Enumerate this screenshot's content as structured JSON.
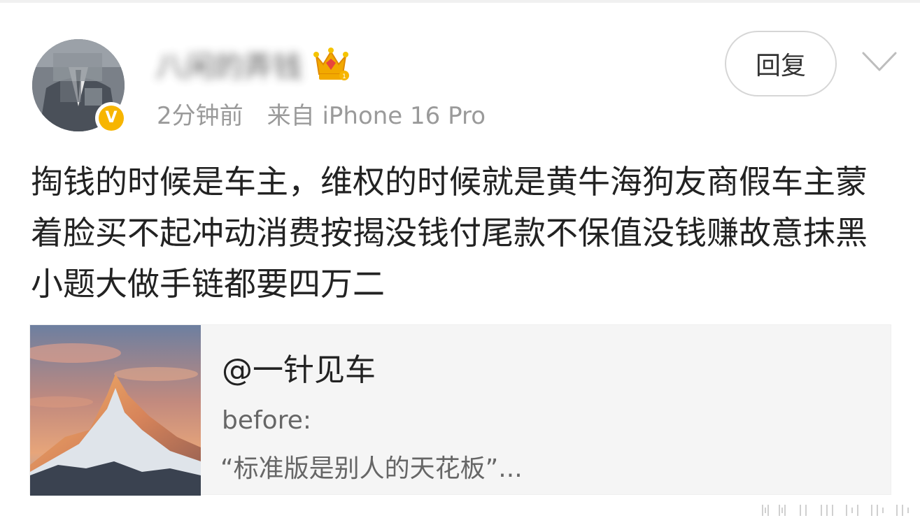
{
  "post": {
    "author": {
      "name": "八闲的弄钱",
      "verified_label": "V"
    },
    "meta": {
      "time": "2分钟前",
      "source": "来自 iPhone 16 Pro"
    },
    "reply_label": "回复",
    "text": "掏钱的时候是车主，维权的时候就是黄牛海狗友商假车主蒙着脸买不起冲动消费按揭没钱付尾款不保值没钱赚故意抹黑小题大做手链都要四万二",
    "quote_card": {
      "title": "@一针见车",
      "line1": "before:",
      "line2": "“标准版是别人的天花板”..."
    }
  },
  "icons": {
    "crown": "crown-icon",
    "verified": "verified-badge-icon",
    "more": "chevron-down-icon"
  },
  "colors": {
    "verified": "#f7b500",
    "meta_text": "#9a9a9a",
    "card_bg": "#f5f5f5"
  }
}
